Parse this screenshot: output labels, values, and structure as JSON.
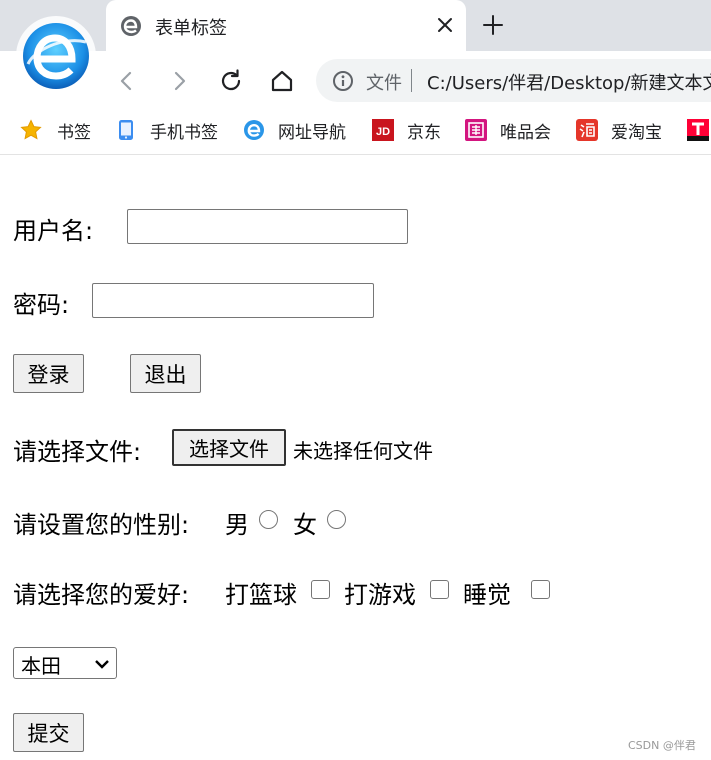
{
  "browser": {
    "tab": {
      "title": "表单标签",
      "favicon": "edge-e-icon"
    },
    "close_icon": "close-icon",
    "new_tab_icon": "plus-icon",
    "nav": [
      "back-icon",
      "forward-icon",
      "reload-icon",
      "home-icon"
    ],
    "omnibox": {
      "label": "文件",
      "url": "C:/Users/伴君/Desktop/新建文本文"
    },
    "bookmarks": [
      {
        "label": "书签",
        "icon": "star-icon"
      },
      {
        "label": "手机书签",
        "icon": "phone-icon"
      },
      {
        "label": "网址导航",
        "icon": "browser-e-icon"
      },
      {
        "label": "京东",
        "icon": "jd-logo-icon"
      },
      {
        "label": "唯品会",
        "icon": "vip-logo-icon"
      },
      {
        "label": "爱淘宝",
        "icon": "taobao-logo-icon"
      },
      {
        "label": "",
        "icon": "tmall-logo-icon"
      }
    ]
  },
  "form": {
    "username_label": "用户名:",
    "username_value": "",
    "password_label": "密码:",
    "password_value": "",
    "login_button": "登录",
    "exit_button": "退出",
    "file_label": "请选择文件:",
    "file_button": "选择文件",
    "file_status": "未选择任何文件",
    "gender_label": "请设置您的性别:",
    "gender_options": [
      "男",
      "女"
    ],
    "hobby_label": "请选择您的爱好:",
    "hobby_options": [
      "打篮球",
      "打游戏",
      "睡觉"
    ],
    "select_value": "本田",
    "submit_button": "提交"
  },
  "watermark": "CSDN @伴君",
  "colors": {
    "chrome": "#dee1e6",
    "accent": "#1a73e8"
  }
}
